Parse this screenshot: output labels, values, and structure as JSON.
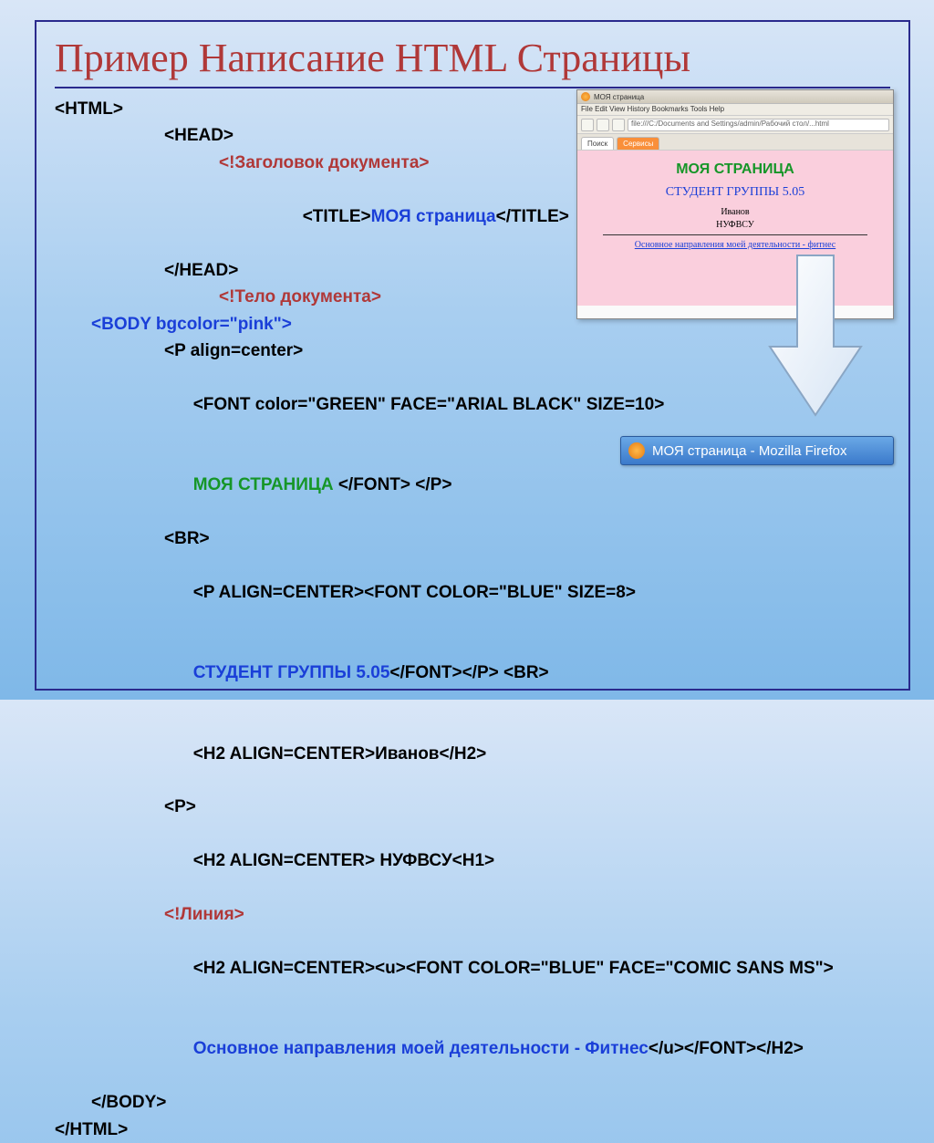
{
  "title": "Пример Написание HTML Страницы",
  "code": {
    "l1": "<HTML>",
    "l2": "<HEAD>",
    "l3": "<!Заголовок документа>",
    "l4a": "<TITLE>",
    "l4b": "МОЯ страница",
    "l4c": "</TITLE>",
    "l5": "</HEAD>",
    "l6": "<!Тело документа>",
    "l7": "<BODY bgcolor=\"pink\">",
    "l8": "<P align=center>",
    "l9a": "<FONT color=\"GREEN\" FACE=",
    "l9b": "\"ARIAL BLACK\"",
    "l9c": " SIZE=10>",
    "l10a": "МОЯ СТРАНИЦА",
    "l10b": " </FONT> </P>",
    "l11": "<BR>",
    "l12a": "<P ALIGN=CENTER><FONT COLOR=",
    "l12b": "\"BLUE\"",
    "l12c": " SIZE=8>",
    "l13a": "СТУДЕНТ ГРУППЫ 5.05",
    "l13b": "</FONT></P>",
    "l13c": "<BR>",
    "l14a": "<H2 ALIGN=CENTER>",
    "l14b": "Иванов",
    "l14c": "</H2>",
    "l15": "<P>",
    "l16a": "<H2 ALIGN=CENTER> ",
    "l16b": "НУФВСУ",
    "l16c": "<H1>",
    "l17": "<!Линия>",
    "l18a": "<H2 ALIGN=CENTER><u><FONT COLOR=",
    "l18b": "\"BLUE\"",
    "l18c": " FACE=\"COMIC SANS MS\">",
    "l19a": "Основное направления моей деятельности - Фитнес",
    "l19b": "</u></FONT></H2>",
    "l20": "</BODY>",
    "l21": "</HTML>"
  },
  "browser": {
    "title_tab": "МОЯ страница",
    "menu": "File  Edit  View  History  Bookmarks  Tools  Help",
    "addr": "file:///C:/Documents and Settings/admin/Рабочий стол/...html",
    "tab1": "Поиск",
    "tab2": "Сервисы",
    "page_h1": "МОЯ СТРАНИЦА",
    "page_h2": "СТУДЕНТ ГРУППЫ 5.05",
    "page_l1": "Иванов",
    "page_l2": "НУФВСУ",
    "page_link": "Основное направления моей деятельности - фитнес"
  },
  "ff_button": "МОЯ страница - Mozilla Firefox"
}
